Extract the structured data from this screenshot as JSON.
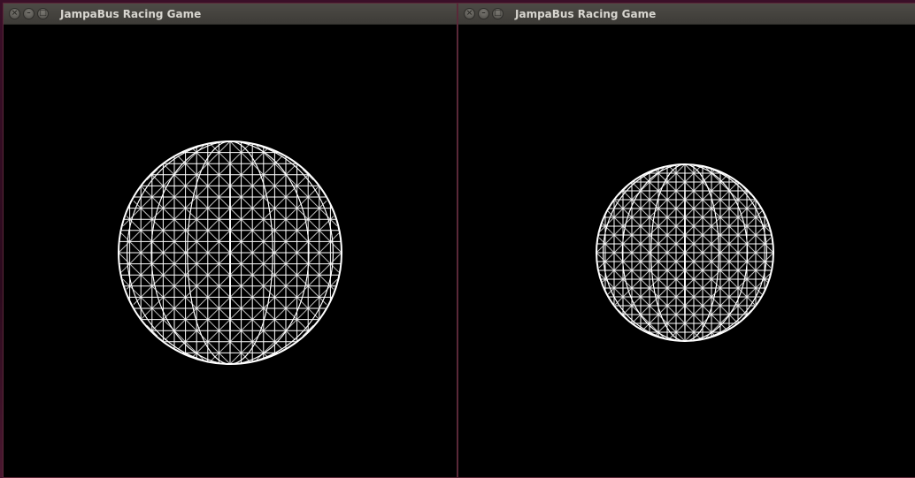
{
  "windows": [
    {
      "title": "JampaBus Racing Game",
      "controls": [
        "close-icon",
        "minimize-icon",
        "maximize-icon"
      ],
      "scene": "wireframe-sphere"
    },
    {
      "title": "JampaBus Racing Game",
      "controls": [
        "close-icon",
        "minimize-icon",
        "maximize-icon"
      ],
      "scene": "wireframe-sphere"
    }
  ],
  "colors": {
    "titlebar": "#454340",
    "title_text": "#d8d6d0",
    "canvas_bg": "#000000",
    "wireframe": "#ffffff"
  }
}
